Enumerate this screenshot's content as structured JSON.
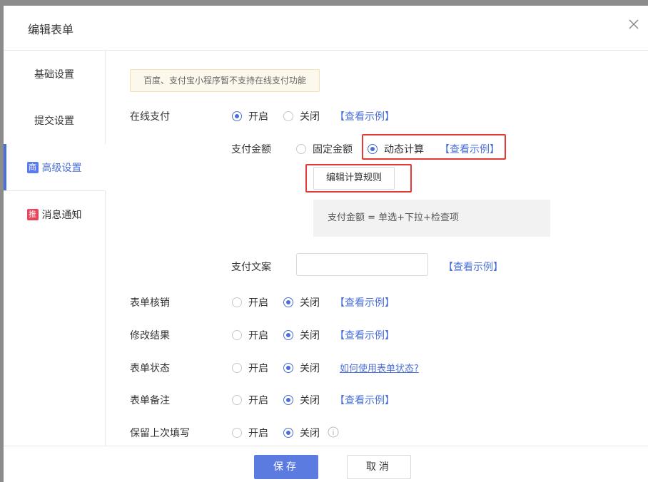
{
  "dialog": {
    "title": "编辑表单"
  },
  "sidebar": {
    "items": [
      {
        "label": "基础设置"
      },
      {
        "label": "提交设置"
      },
      {
        "label": "高级设置",
        "badge": "商",
        "active": true
      },
      {
        "label": "消息通知",
        "badge": "推"
      }
    ]
  },
  "notice": "百度、支付宝小程序暂不支持在线支付功能",
  "online_payment": {
    "label": "在线支付",
    "on": "开启",
    "off": "关闭",
    "link": "【查看示例】",
    "amount_label": "支付金额",
    "fixed": "固定金额",
    "dynamic": "动态计算",
    "amount_link": "【查看示例】",
    "edit_rule_button": "编辑计算规则",
    "formula": "支付金额 = 单选+下拉+检查项",
    "copy_label": "支付文案",
    "copy_value": "",
    "copy_link": "【查看示例】"
  },
  "settings": [
    {
      "label": "表单核销",
      "on": "开启",
      "off": "关闭",
      "link": "【查看示例】"
    },
    {
      "label": "修改结果",
      "on": "开启",
      "off": "关闭",
      "link": "【查看示例】"
    },
    {
      "label": "表单状态",
      "on": "开启",
      "off": "关闭",
      "link": "如何使用表单状态?"
    },
    {
      "label": "表单备注",
      "on": "开启",
      "off": "关闭",
      "link": "【查看示例】"
    },
    {
      "label": "保留上次填写",
      "on": "开启",
      "off": "关闭"
    }
  ],
  "footer": {
    "save": "保存",
    "cancel": "取消"
  },
  "colors": {
    "accent": "#4a6fd8",
    "highlight": "#e53935",
    "save_bg": "#5b7be0"
  }
}
